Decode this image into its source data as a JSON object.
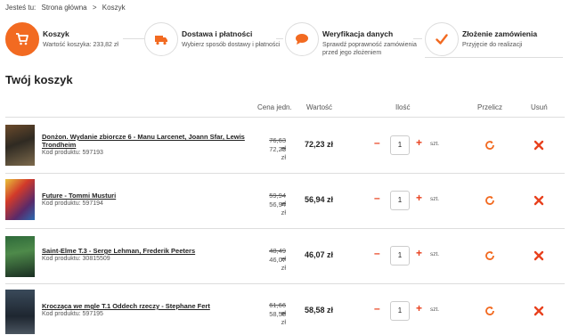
{
  "breadcrumb": {
    "label": "Jesteś tu:",
    "home": "Strona główna",
    "sep": ">",
    "current": "Koszyk"
  },
  "steps": [
    {
      "title": "Koszyk",
      "desc": "Wartość koszyka: 233,82 zł",
      "icon": "cart-icon"
    },
    {
      "title": "Dostawa i płatności",
      "desc": "Wybierz sposób dostawy i płatności",
      "icon": "truck-icon"
    },
    {
      "title": "Weryfikacja danych",
      "desc": "Sprawdź poprawność zamówienia przed jego złożeniem",
      "icon": "speech-bubble-icon"
    },
    {
      "title": "Złożenie zamówienia",
      "desc": "Przyjęcie do realizacji",
      "icon": "check-icon"
    }
  ],
  "cart_title": "Twój koszyk",
  "headers": {
    "unit_price": "Cena jedn.",
    "value": "Wartość",
    "quantity": "Ilość",
    "recalc": "Przelicz",
    "remove": "Usuń"
  },
  "items": [
    {
      "name": "Donżon. Wydanie zbiorcze 6 - Manu Larcenet, Joann Sfar, Lewis Trondheim",
      "code": "Kod produktu: 597193",
      "old_price": "76,63 zł",
      "price": "72,23 zł",
      "value": "72,23 zł",
      "qty": "1",
      "unit": "szt."
    },
    {
      "name": "Future - Tommi Musturi",
      "code": "Kod produktu: 597194",
      "old_price": "59,94 zł",
      "price": "56,94 zł",
      "value": "56,94 zł",
      "qty": "1",
      "unit": "szt."
    },
    {
      "name": "Saint-Elme T.3 - Serge Lehman, Frederik Peeters",
      "code": "Kod produktu: 30815509",
      "old_price": "48,49 zł",
      "price": "46,07 zł",
      "value": "46,07 zł",
      "qty": "1",
      "unit": "szt."
    },
    {
      "name": "Krocząca we mgle T.1 Oddech rzeczy - Stephane Fert",
      "code": "Kod produktu: 597195",
      "old_price": "61,66 zł",
      "price": "58,58 zł",
      "value": "58,58 zł",
      "qty": "1",
      "unit": "szt."
    }
  ],
  "controls": {
    "minus": "–",
    "plus": "+"
  },
  "colors": {
    "accent": "#f26a21",
    "danger": "#e8411e"
  }
}
